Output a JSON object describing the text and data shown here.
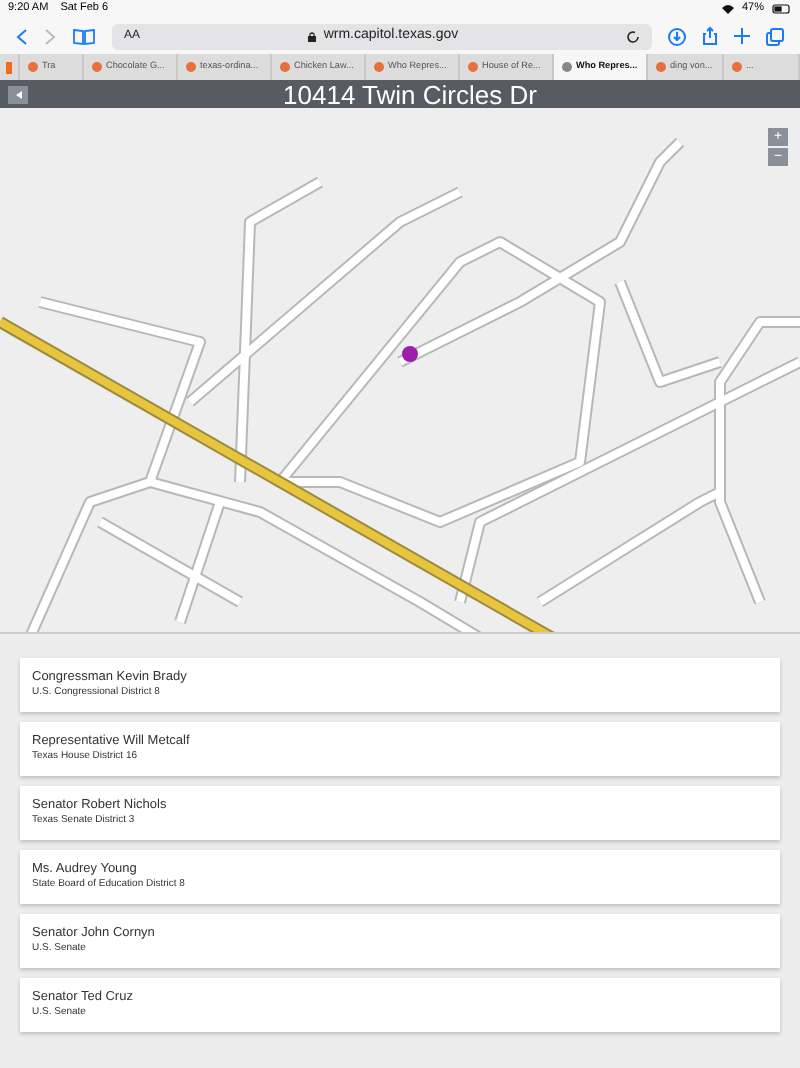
{
  "status_bar": {
    "time": "9:20 AM",
    "date": "Sat Feb 6",
    "battery": "47%"
  },
  "browser": {
    "text_size": "AA",
    "url": "wrm.capitol.texas.gov"
  },
  "tabs": [
    {
      "label": "Tra",
      "selected": false
    },
    {
      "label": "Chocolate G...",
      "selected": false
    },
    {
      "label": "texas-ordina...",
      "selected": false
    },
    {
      "label": "Chicken Law...",
      "selected": false
    },
    {
      "label": "Who Repres...",
      "selected": false
    },
    {
      "label": "House of Re...",
      "selected": false
    },
    {
      "label": "Who Repres...",
      "selected": true
    },
    {
      "label": "ding von...",
      "selected": false
    },
    {
      "label": "...",
      "selected": false
    }
  ],
  "page": {
    "title": "10414 Twin Circles Dr"
  },
  "map": {
    "kind": "picture",
    "zoom_in": "+",
    "zoom_out": "−"
  },
  "officials": [
    {
      "name": "Congressman Kevin Brady",
      "office": "U.S. Congressional District 8"
    },
    {
      "name": "Representative Will Metcalf",
      "office": "Texas House District 16"
    },
    {
      "name": "Senator Robert Nichols",
      "office": "Texas Senate District 3"
    },
    {
      "name": "Ms. Audrey Young",
      "office": "State Board of Education District 8"
    },
    {
      "name": "Senator John Cornyn",
      "office": "U.S. Senate"
    },
    {
      "name": "Senator Ted Cruz",
      "office": "U.S. Senate"
    }
  ]
}
